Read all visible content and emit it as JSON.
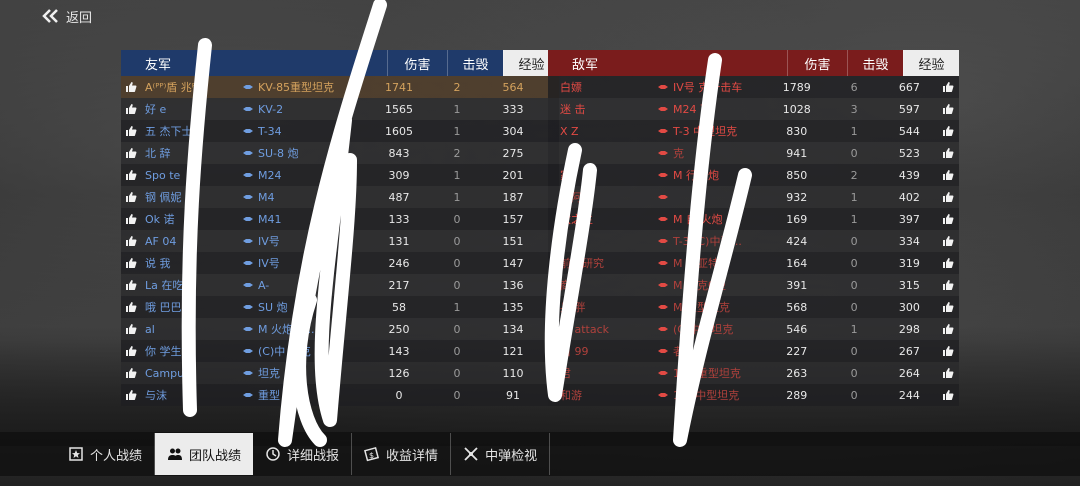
{
  "top": {
    "back_label": "返回"
  },
  "allies": {
    "title": "友军",
    "col_damage": "伤害",
    "col_kills": "击毁",
    "col_exp": "经验",
    "rows": [
      {
        "name": "A⁽ᴾᴾ⁾盾 兆ᴾᴾA",
        "tank": "KV-85重型坦克",
        "damage": "1741",
        "kills": "2",
        "exp": "564",
        "highlight": true
      },
      {
        "name": "好 e",
        "tank": "KV-2",
        "damage": "1565",
        "kills": "1",
        "exp": "333"
      },
      {
        "name": "五 杰下士",
        "tank": "T-34",
        "damage": "1605",
        "kills": "1",
        "exp": "304"
      },
      {
        "name": "北 辞",
        "tank": "SU-8 炮",
        "damage": "843",
        "kills": "2",
        "exp": "275"
      },
      {
        "name": "Spo te",
        "tank": "M24",
        "damage": "309",
        "kills": "1",
        "exp": "201"
      },
      {
        "name": "钢 佩妮",
        "tank": "M4",
        "damage": "487",
        "kills": "1",
        "exp": "187"
      },
      {
        "name": "Ok 诺",
        "tank": "M41",
        "damage": "133",
        "kills": "0",
        "exp": "157"
      },
      {
        "name": "AF 04",
        "tank": "IV号",
        "damage": "131",
        "kills": "0",
        "exp": "151"
      },
      {
        "name": "说 我",
        "tank": "IV号",
        "damage": "246",
        "kills": "0",
        "exp": "147"
      },
      {
        "name": "La 在吃饭",
        "tank": "A-",
        "damage": "217",
        "kills": "0",
        "exp": "136"
      },
      {
        "name": "哦 巴巴",
        "tank": "SU 炮",
        "damage": "58",
        "kills": "1",
        "exp": "135"
      },
      {
        "name": "al",
        "tank": "M 火炮 载...",
        "damage": "250",
        "kills": "0",
        "exp": "134"
      },
      {
        "name": "你 学生",
        "tank": "(C)中 坦克",
        "damage": "143",
        "kills": "0",
        "exp": "121"
      },
      {
        "name": "Campus",
        "tank": "坦克",
        "damage": "126",
        "kills": "0",
        "exp": "110"
      },
      {
        "name": "与沫",
        "tank": "重型",
        "damage": "0",
        "kills": "0",
        "exp": "91"
      }
    ]
  },
  "enemies": {
    "title": "敌军",
    "col_damage": "伤害",
    "col_kills": "击毁",
    "col_exp": "经验",
    "rows": [
      {
        "name": "白嫖",
        "tank": "IV号 克歼击车",
        "damage": "1789",
        "kills": "6",
        "exp": "667"
      },
      {
        "name": "迷 击",
        "tank": "M24 飞",
        "damage": "1028",
        "kills": "3",
        "exp": "597"
      },
      {
        "name": "X Z",
        "tank": "T-3 中型坦克",
        "damage": "830",
        "kills": "1",
        "exp": "544"
      },
      {
        "name": "",
        "tank": "克",
        "damage": "941",
        "kills": "0",
        "exp": "523",
        "dim": true
      },
      {
        "name": "家",
        "tank": "M 行火炮",
        "damage": "850",
        "kills": "2",
        "exp": "439"
      },
      {
        "name": "爵阿伟",
        "tank": "",
        "damage": "932",
        "kills": "1",
        "exp": "402",
        "dim": true
      },
      {
        "name": "教之主",
        "tank": "M 自 火炮",
        "damage": "169",
        "kills": "1",
        "exp": "397"
      },
      {
        "name": "",
        "tank": "T-3 (C)中型...",
        "damage": "424",
        "kills": "0",
        "exp": "334",
        "dim": true
      },
      {
        "name": "前来研究",
        "tank": "M 凯亚特",
        "damage": "164",
        "kills": "0",
        "exp": "319",
        "dim": true
      },
      {
        "name": "商",
        "tank": "M 坦克0型",
        "damage": "391",
        "kills": "0",
        "exp": "315",
        "dim": true
      },
      {
        "name": "兵 胖",
        "tank": "M 重型坦克",
        "damage": "568",
        "kills": "0",
        "exp": "300",
        "dim": true
      },
      {
        "name": "放 attack",
        "tank": "(C)中型坦克",
        "damage": "546",
        "kills": "1",
        "exp": "298",
        "dim": true
      },
      {
        "name": "白 99",
        "tank": "者",
        "damage": "227",
        "kills": "0",
        "exp": "267",
        "dim": true
      },
      {
        "name": "君",
        "tank": "1(H)重型坦克",
        "damage": "263",
        "kills": "0",
        "exp": "264",
        "dim": true
      },
      {
        "name": "和游",
        "tank": "1(T)中型坦克",
        "damage": "289",
        "kills": "0",
        "exp": "244",
        "dim": true
      }
    ]
  },
  "tabs": [
    {
      "label": "个人战绩",
      "icon": "medal-icon",
      "active": false
    },
    {
      "label": "团队战绩",
      "icon": "team-icon",
      "active": true
    },
    {
      "label": "详细战报",
      "icon": "report-icon",
      "active": false
    },
    {
      "label": "收益详情",
      "icon": "money-icon",
      "active": false
    },
    {
      "label": "中弹检视",
      "icon": "hit-inspect-icon",
      "active": false
    }
  ],
  "colors": {
    "ally_header": "#1f3a6a",
    "enemy_header": "#7a1c1c",
    "ally_text": "#6f9de0",
    "enemy_text": "#e24a44"
  }
}
